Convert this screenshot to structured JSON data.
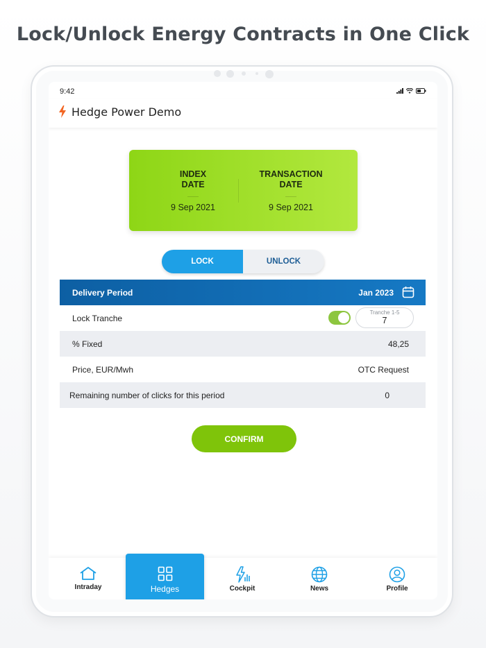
{
  "headline": "Lock/Unlock Energy Contracts in One Click",
  "status_bar": {
    "time": "9:42"
  },
  "app": {
    "title": "Hedge Power Demo"
  },
  "date_card": {
    "index_label": "INDEX\nDATE",
    "index_value": "9 Sep 2021",
    "transaction_label": "TRANSACTION\nDATE",
    "transaction_value": "9 Sep 2021"
  },
  "mode_toggle": {
    "options": [
      "LOCK",
      "UNLOCK"
    ],
    "selected": "LOCK"
  },
  "table": {
    "header": {
      "label": "Delivery Period",
      "value": "Jan 2023"
    },
    "rows": [
      {
        "label": "Lock Tranche",
        "toggle_on": true,
        "tranche_caption": "Tranche 1-5",
        "tranche_value": "7"
      },
      {
        "label": "% Fixed",
        "value": "48,25"
      },
      {
        "label": "Price, EUR/Mwh",
        "value": "OTC Request"
      },
      {
        "label": "Remaining number of clicks for this period",
        "value": "0"
      }
    ]
  },
  "confirm_label": "CONFIRM",
  "tabs": [
    {
      "label": "Intraday",
      "icon": "house-icon"
    },
    {
      "label": "Hedges",
      "icon": "grid-icon",
      "active": true
    },
    {
      "label": "Cockpit",
      "icon": "bolt-chart-icon"
    },
    {
      "label": "News",
      "icon": "globe-icon"
    },
    {
      "label": "Profile",
      "icon": "user-circle-icon"
    }
  ],
  "colors": {
    "accent_blue": "#1ea0e6",
    "header_blue": "#0d5fa3",
    "brand_green": "#7fc40a",
    "bolt_orange": "#f26522"
  }
}
